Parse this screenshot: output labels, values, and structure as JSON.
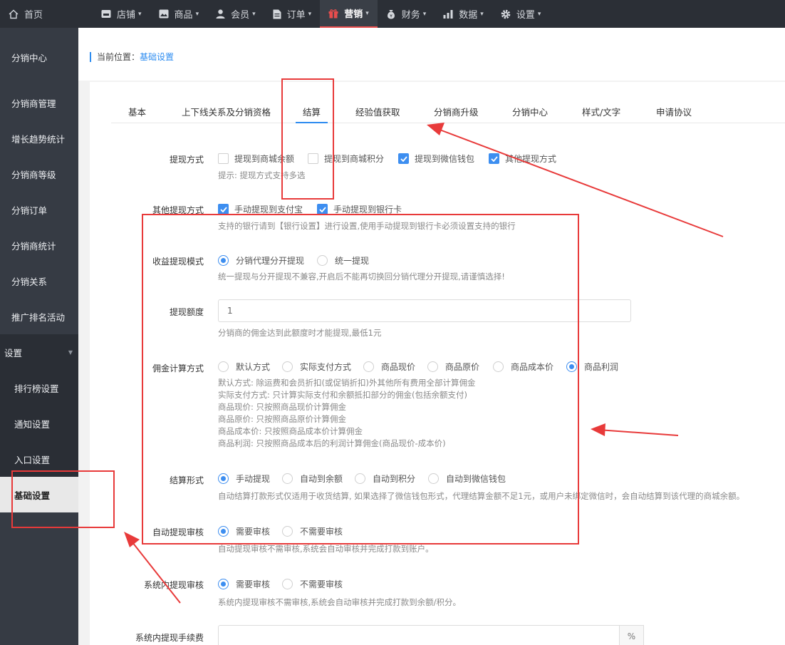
{
  "home": {
    "label": "首页"
  },
  "topnav": [
    {
      "label": "店铺",
      "icon": "store-icon"
    },
    {
      "label": "商品",
      "icon": "image-icon"
    },
    {
      "label": "会员",
      "icon": "user-icon"
    },
    {
      "label": "订单",
      "icon": "document-icon"
    },
    {
      "label": "营销",
      "icon": "gift-icon"
    },
    {
      "label": "财务",
      "icon": "money-bag-icon"
    },
    {
      "label": "数据",
      "icon": "bar-chart-icon"
    },
    {
      "label": "设置",
      "icon": "gear-icon"
    }
  ],
  "sidebar": {
    "title": "分销中心",
    "items": [
      "分销商管理",
      "增长趋势统计",
      "分销商等级",
      "分销订单",
      "分销商统计",
      "分销关系",
      "推广排名活动"
    ],
    "group": "设置",
    "subitems": [
      "排行榜设置",
      "通知设置",
      "入口设置",
      "基础设置"
    ]
  },
  "breadcrumb": {
    "prefix": "当前位置：",
    "current": "基础设置"
  },
  "tabs": [
    "基本",
    "上下线关系及分销资格",
    "结算",
    "经验值获取",
    "分销商升级",
    "分销中心",
    "样式/文字",
    "申请协议"
  ],
  "form": {
    "withdraw_method": {
      "label": "提现方式",
      "options": [
        {
          "label": "提现到商城余额",
          "checked": false
        },
        {
          "label": "提现到商城积分",
          "checked": false
        },
        {
          "label": "提现到微信钱包",
          "checked": true
        },
        {
          "label": "其他提现方式",
          "checked": true
        }
      ],
      "hint": "提示: 提现方式支持多选"
    },
    "other_method": {
      "label": "其他提现方式",
      "options": [
        {
          "label": "手动提现到支付宝",
          "checked": true
        },
        {
          "label": "手动提现到银行卡",
          "checked": true
        }
      ],
      "hint": "支持的银行请到【银行设置】进行设置,使用手动提现到银行卡必须设置支持的银行"
    },
    "income_mode": {
      "label": "收益提现模式",
      "options": [
        {
          "label": "分销代理分开提现",
          "checked": true
        },
        {
          "label": "统一提现",
          "checked": false
        }
      ],
      "hint": "统一提现与分开提现不兼容,开启后不能再切换回分销代理分开提现,请谨慎选择!"
    },
    "limit": {
      "label": "提现额度",
      "value": "1",
      "hint": "分销商的佣金达到此额度时才能提现,最低1元"
    },
    "commission": {
      "label": "佣金计算方式",
      "options": [
        {
          "label": "默认方式",
          "checked": false
        },
        {
          "label": "实际支付方式",
          "checked": false
        },
        {
          "label": "商品现价",
          "checked": false
        },
        {
          "label": "商品原价",
          "checked": false
        },
        {
          "label": "商品成本价",
          "checked": false
        },
        {
          "label": "商品利润",
          "checked": true
        }
      ],
      "hints": [
        "默认方式: 除运费和会员折扣(或促销折扣)外其他所有费用全部计算佣金",
        "实际支付方式: 只计算实际支付和余额抵扣部分的佣金(包括余额支付)",
        "商品现价: 只按照商品现价计算佣金",
        "商品原价: 只按照商品原价计算佣金",
        "商品成本价: 只按照商品成本价计算佣金",
        "商品利润: 只按照商品成本后的利润计算佣金(商品现价-成本价)"
      ]
    },
    "settle_form": {
      "label": "结算形式",
      "options": [
        {
          "label": "手动提现",
          "checked": true
        },
        {
          "label": "自动到余额",
          "checked": false
        },
        {
          "label": "自动到积分",
          "checked": false
        },
        {
          "label": "自动到微信钱包",
          "checked": false
        }
      ],
      "hint": "自动结算打款形式仅适用于收货结算, 如果选择了微信钱包形式，代理结算金额不足1元，或用户未绑定微信时，会自动结算到该代理的商城余额。"
    },
    "auto_audit": {
      "label": "自动提现审核",
      "options": [
        {
          "label": "需要审核",
          "checked": true
        },
        {
          "label": "不需要审核",
          "checked": false
        }
      ],
      "hint": "自动提现审核不需审核,系统会自动审核并完成打款到账户。"
    },
    "inner_audit": {
      "label": "系统内提现审核",
      "options": [
        {
          "label": "需要审核",
          "checked": true
        },
        {
          "label": "不需要审核",
          "checked": false
        }
      ],
      "hint": "系统内提现审核不需审核,系统会自动审核并完成打款到余额/积分。"
    },
    "inner_fee": {
      "label": "系统内提现手续费",
      "value": "",
      "unit": "%"
    }
  },
  "colors": {
    "accent": "#2d8cf0",
    "annotation": "#e83a3a",
    "topbar": "#2b2f36",
    "sidebar": "#363b44"
  }
}
